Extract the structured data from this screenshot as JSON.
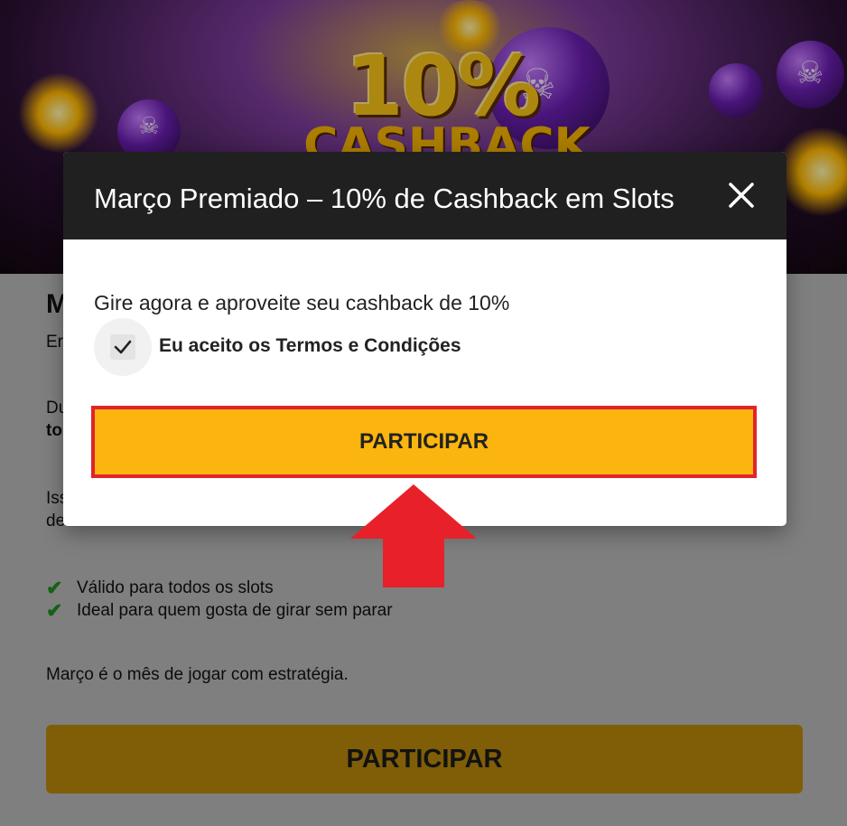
{
  "banner": {
    "headline": "10%",
    "subline": "CASHBACK"
  },
  "page": {
    "heading_fragment": "M",
    "line1_fragment": "Er",
    "line2_fragment": "Du",
    "line3_fragment": "to",
    "line4_fragment": "Iss",
    "line5_fragment": "de",
    "bullets": [
      "Válido para todos os slots",
      "Ideal para quem gosta de girar sem parar"
    ],
    "closing_text": "Março é o mês de jogar com estratégia.",
    "cta_label": "PARTICIPAR"
  },
  "modal": {
    "title": "Março Premiado – 10% de Cashback em Slots",
    "body_text": "Gire agora e aproveite seu cashback de 10%",
    "checkbox_label": "Eu aceito os Termos e Condições",
    "checkbox_checked": true,
    "cta_label": "PARTICIPAR",
    "close_icon": "close-icon"
  },
  "colors": {
    "modal_header_bg": "#202020",
    "modal_cta_bg": "#fbb50e",
    "modal_cta_border": "#e0242c",
    "page_cta_bg": "#b8860b",
    "arrow": "#e8202a",
    "check_green": "#1e8c1e"
  },
  "annotation": {
    "arrow_icon": "red-up-arrow-icon"
  }
}
